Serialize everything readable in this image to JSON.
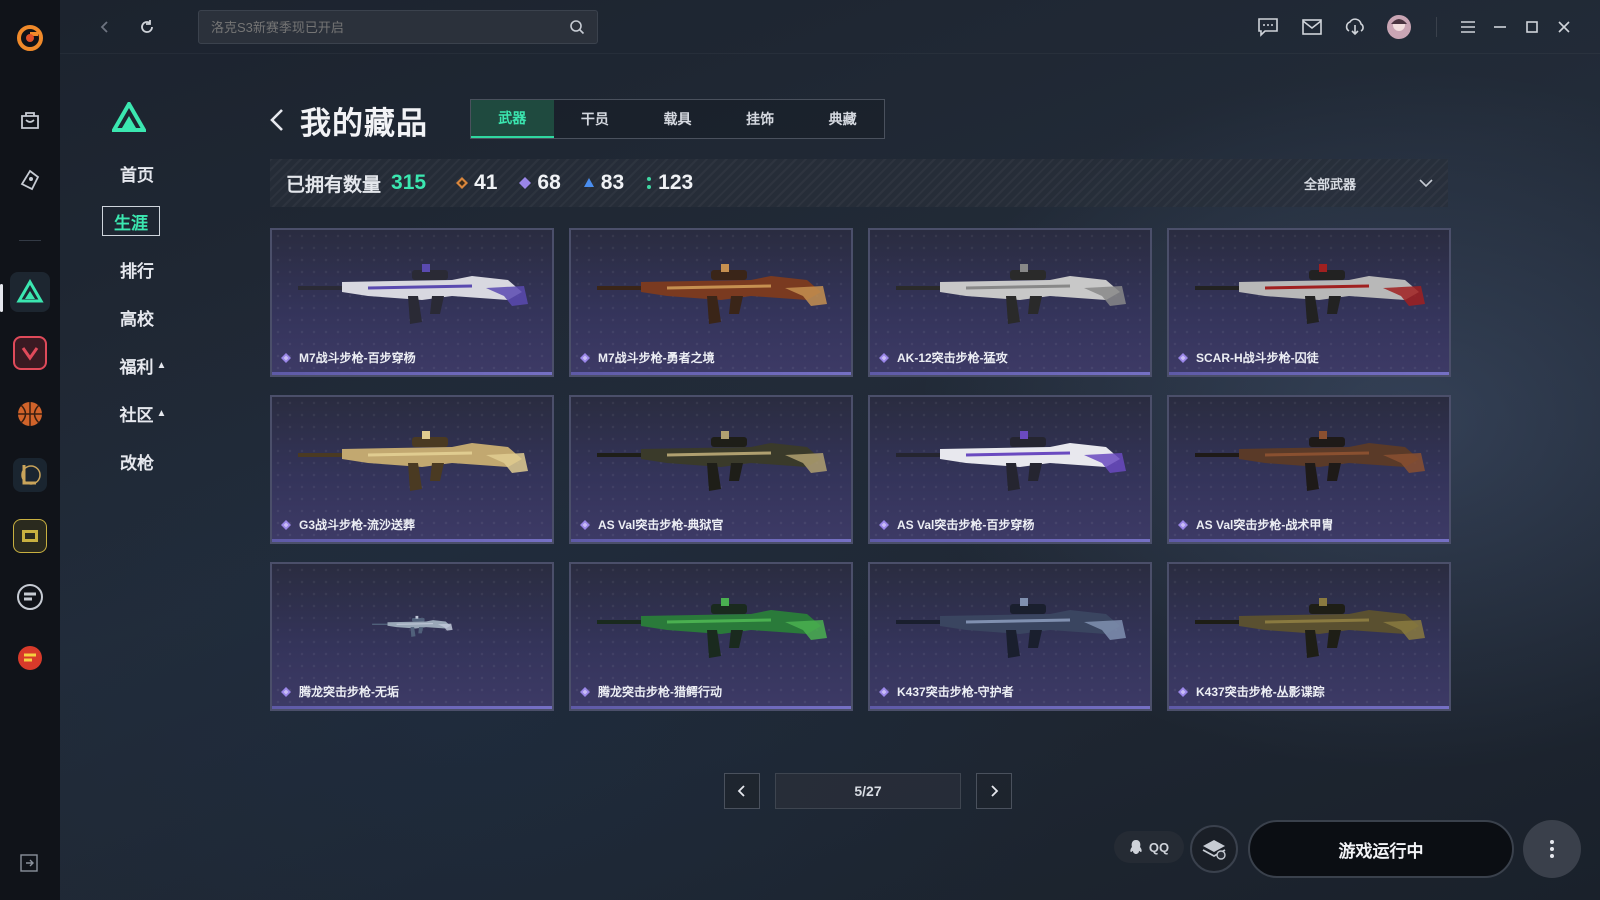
{
  "rail": {
    "games": [
      "bag-icon",
      "tag-icon",
      "delta-force-icon",
      "valorant-icon",
      "basketball-icon",
      "league-icon",
      "call-of-duty-icon",
      "crossfire-hd-icon",
      "crossfire-icon"
    ]
  },
  "topbar": {
    "search_placeholder": "洛克S3新赛季现已开启"
  },
  "nav": {
    "items": [
      {
        "label": "首页"
      },
      {
        "label": "生涯"
      },
      {
        "label": "排行"
      },
      {
        "label": "高校"
      },
      {
        "label": "福利"
      },
      {
        "label": "社区"
      },
      {
        "label": "改枪"
      }
    ]
  },
  "header": {
    "title": "我的藏品",
    "tabs": [
      "武器",
      "干员",
      "载具",
      "挂饰",
      "典藏"
    ],
    "active_tab": "武器"
  },
  "stats": {
    "owned_label": "已拥有数量",
    "owned_count": "315",
    "tiers": [
      {
        "count": "41",
        "color": "#d9863c"
      },
      {
        "count": "68",
        "color": "#9a86e8"
      },
      {
        "count": "83",
        "color": "#4a8ef0"
      },
      {
        "count": "123",
        "color": "#3fd8a4"
      }
    ],
    "filter_label": "全部武器"
  },
  "items": [
    {
      "name": "M7战斗步枪-百步穿杨",
      "palette": [
        "#d8d8e0",
        "#2a2a35",
        "#5a4ab0"
      ]
    },
    {
      "name": "M7战斗步枪-勇者之境",
      "palette": [
        "#7a3a20",
        "#3a2518",
        "#c69050"
      ]
    },
    {
      "name": "AK-12突击步枪-猛攻",
      "palette": [
        "#c8c8c8",
        "#2a2a2a",
        "#888888"
      ]
    },
    {
      "name": "SCAR-H战斗步枪-囚徒",
      "palette": [
        "#b8b8b8",
        "#222222",
        "#a02020"
      ]
    },
    {
      "name": "G3战斗步枪-流沙送葬",
      "palette": [
        "#c2a870",
        "#4a3a22",
        "#e0cc90"
      ]
    },
    {
      "name": "AS Val突击步枪-典狱官",
      "palette": [
        "#3a3a2a",
        "#1e1e18",
        "#b0a070"
      ]
    },
    {
      "name": "AS Val突击步枪-百步穿杨",
      "palette": [
        "#e8e8ee",
        "#252530",
        "#6a4ac0"
      ]
    },
    {
      "name": "AS Val突击步枪-战术甲胄",
      "palette": [
        "#5a3a28",
        "#1e1a18",
        "#8a5030"
      ]
    },
    {
      "name": "腾龙突击步枪-无垢",
      "palette": [
        "#9aa8b8",
        "#50607a",
        "#c0c8d8"
      ]
    },
    {
      "name": "腾龙突击步枪-猎鳄行动",
      "palette": [
        "#2a7a3a",
        "#1a2a1e",
        "#4ab050"
      ]
    },
    {
      "name": "K437突击步枪-守护者",
      "palette": [
        "#3a4560",
        "#1a1f2e",
        "#8090b0"
      ]
    },
    {
      "name": "K437突击步枪-丛影谍踪",
      "palette": [
        "#5a5030",
        "#1e1e16",
        "#8a7a40"
      ]
    }
  ],
  "item_rarity_color": "#9a86e8",
  "pager": {
    "display": "5/27"
  },
  "bottom": {
    "qq_label": "QQ",
    "run_label": "游戏运行中"
  },
  "colors": {
    "accent": "#3be7b0",
    "card_border": "#4b4f6a"
  }
}
